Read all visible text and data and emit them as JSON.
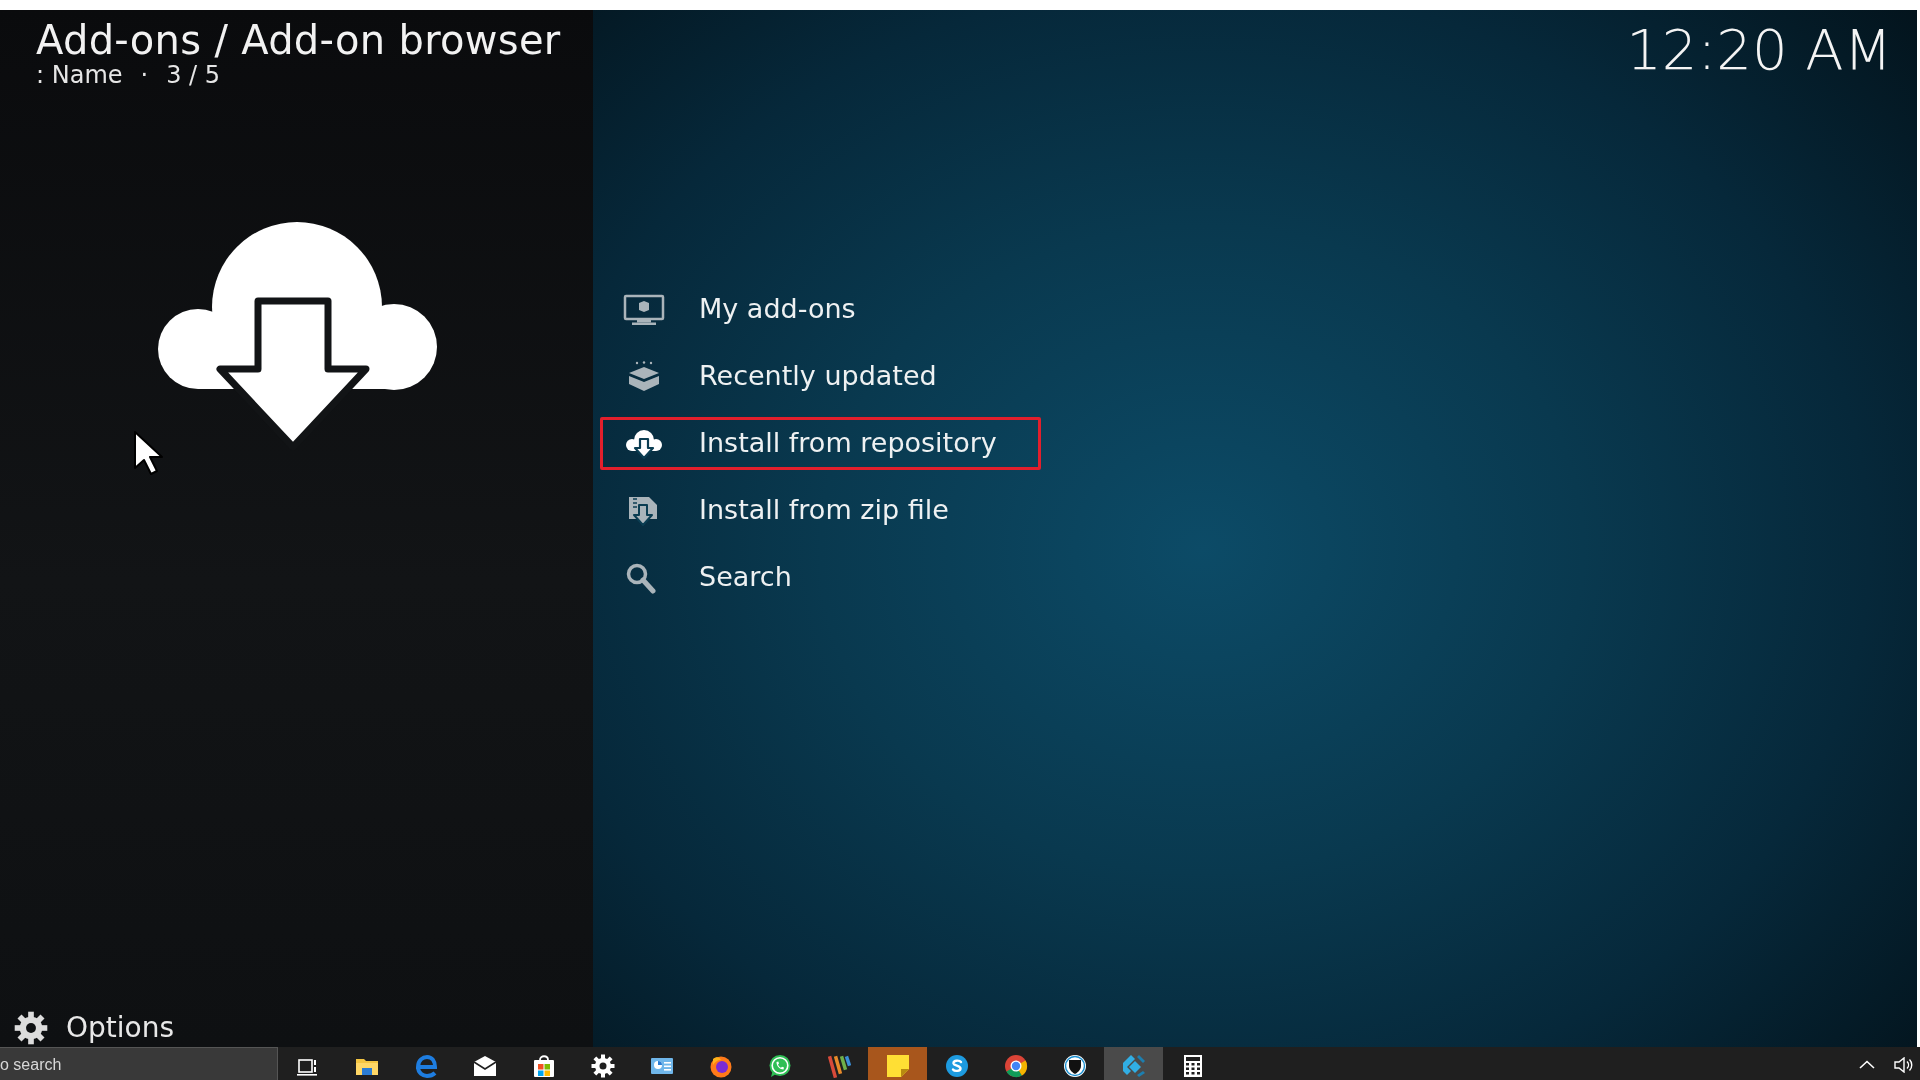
{
  "header": {
    "title": "Add-ons / Add-on browser",
    "sort": ": Name",
    "separator": "·",
    "position": "3 / 5"
  },
  "clock": "12:20 AM",
  "menu": {
    "items": [
      {
        "label": "My add-ons",
        "selected": false
      },
      {
        "label": "Recently updated",
        "selected": false
      },
      {
        "label": "Install from repository",
        "selected": true
      },
      {
        "label": "Install from zip file",
        "selected": false
      },
      {
        "label": "Search",
        "selected": false
      }
    ]
  },
  "options": {
    "label": "Options"
  },
  "taskbar": {
    "search": {
      "placeholder": "o search"
    },
    "apps": [
      {
        "selected": false,
        "flashing": false
      },
      {
        "selected": false,
        "flashing": false
      },
      {
        "selected": false,
        "flashing": false
      },
      {
        "selected": false,
        "flashing": false
      },
      {
        "selected": false,
        "flashing": false
      },
      {
        "selected": false,
        "flashing": false
      },
      {
        "selected": false,
        "flashing": false
      },
      {
        "selected": false,
        "flashing": false
      },
      {
        "selected": false,
        "flashing": false
      },
      {
        "selected": false,
        "flashing": false
      },
      {
        "selected": false,
        "flashing": true
      },
      {
        "selected": false,
        "flashing": false
      },
      {
        "selected": false,
        "flashing": false
      },
      {
        "selected": false,
        "flashing": false
      },
      {
        "selected": true,
        "flashing": false
      },
      {
        "selected": false,
        "flashing": false
      }
    ]
  }
}
